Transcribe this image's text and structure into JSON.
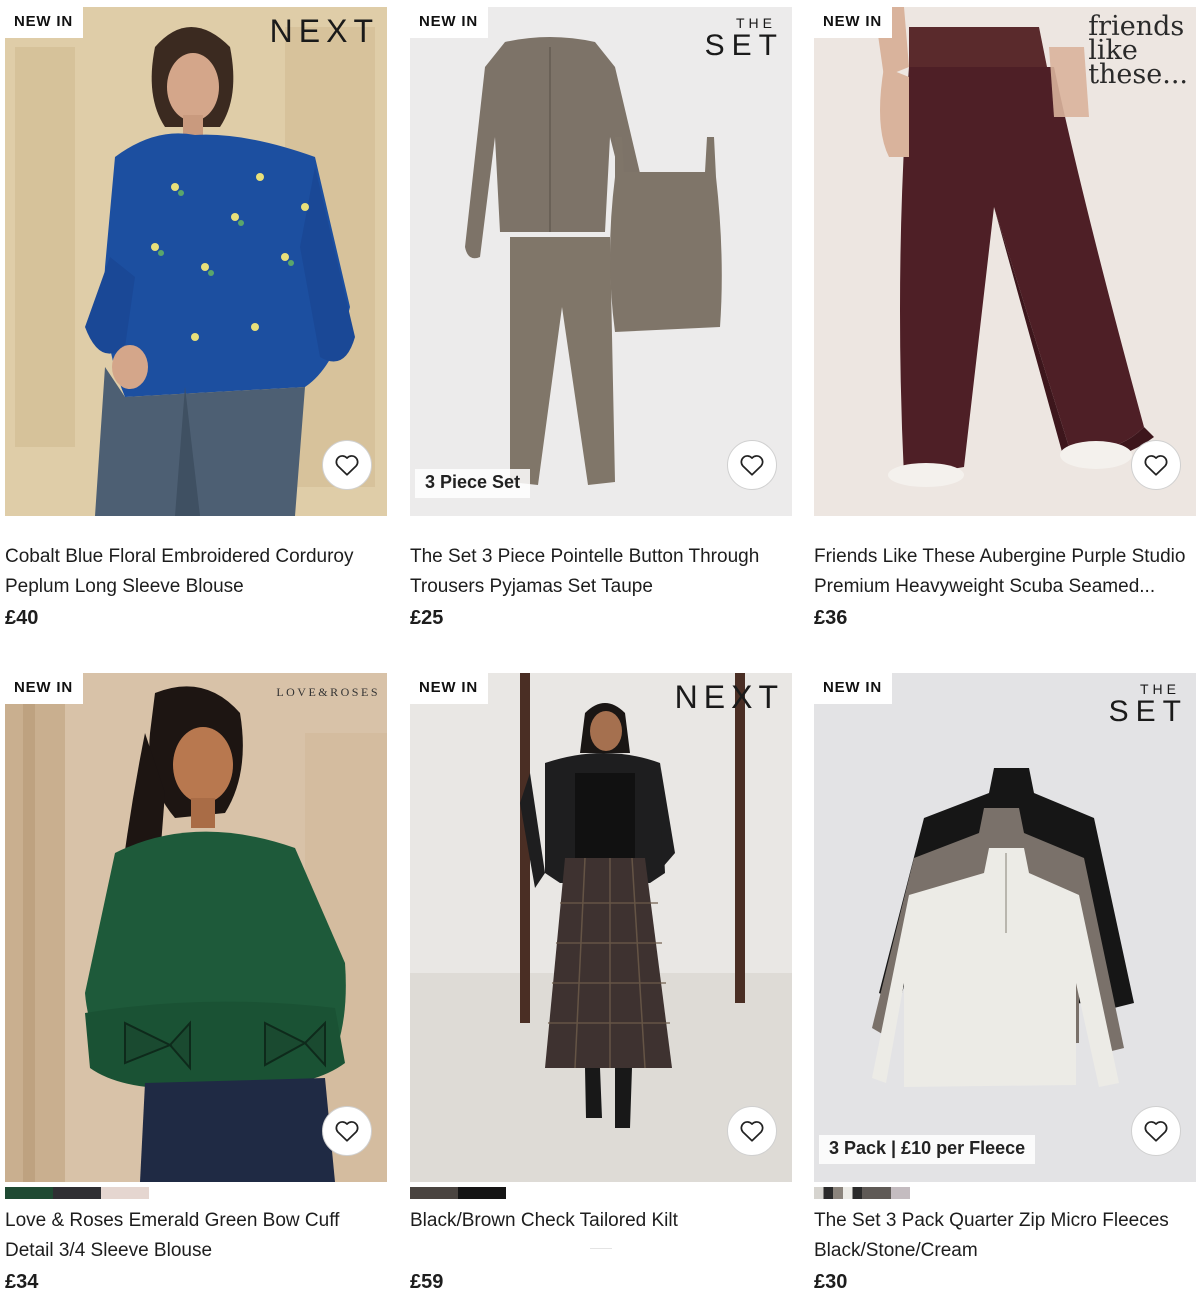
{
  "products": [
    {
      "badge": "NEW IN",
      "brand": "NEXT",
      "title": "Cobalt Blue Floral Embroidered Corduroy Peplum Long Sleeve Blouse",
      "price": "£40",
      "promo": "",
      "swatches": []
    },
    {
      "badge": "NEW IN",
      "brand_top": "THE",
      "brand_bottom": "SET",
      "title": "The Set 3 Piece Pointelle Button Through Trousers Pyjamas Set Taupe",
      "price": "£25",
      "promo": "3 Piece Set",
      "swatches": []
    },
    {
      "badge": "NEW IN",
      "brand_lines": [
        "friends",
        "like",
        "these..."
      ],
      "title": "Friends Like These Aubergine Purple Studio Premium Heavyweight Scuba Seamed...",
      "price": "£36",
      "promo": "",
      "swatches": []
    },
    {
      "badge": "NEW IN",
      "brand": "LOVE&ROSES",
      "title": "Love & Roses Emerald Green Bow Cuff Detail 3/4 Sleeve Blouse",
      "price": "£34",
      "promo": "",
      "swatches": [
        "#1f4a33",
        "#2f2f33",
        "#e5d6d0"
      ]
    },
    {
      "badge": "NEW IN",
      "brand": "NEXT",
      "title": "Black/Brown Check Tailored Kilt",
      "price": "£59",
      "promo": "",
      "swatches": [
        "#4a4440",
        "#151515"
      ]
    },
    {
      "badge": "NEW IN",
      "brand_top": "THE",
      "brand_bottom": "SET",
      "title": "The Set 3 Pack Quarter Zip Micro Fleeces Black/Stone/Cream",
      "price": "£30",
      "promo": "3 Pack | £10 per Fleece",
      "swatches": [
        "#6f6a66",
        "#c4bcc0"
      ]
    }
  ],
  "icons": {
    "favourite": "heart-outline-icon"
  }
}
